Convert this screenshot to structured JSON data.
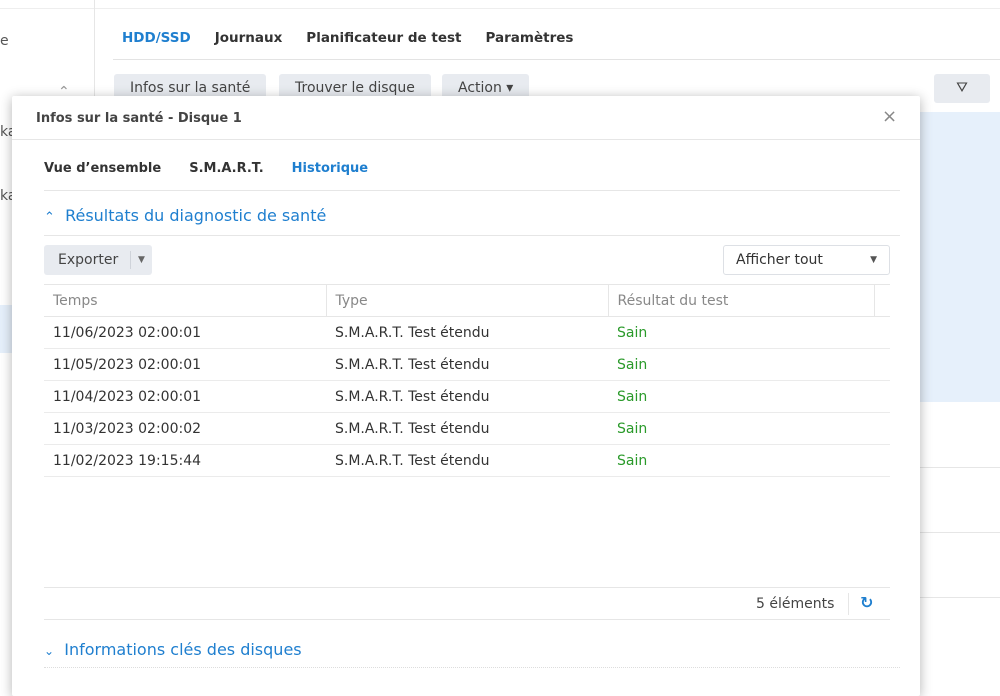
{
  "sidebar": {
    "fragments": [
      "e",
      "ka",
      "ka"
    ]
  },
  "main_tabs": [
    {
      "label": "HDD/SSD"
    },
    {
      "label": "Journaux"
    },
    {
      "label": "Planificateur de test"
    },
    {
      "label": "Paramètres"
    }
  ],
  "toolbar": {
    "health": "Infos sur la santé",
    "find": "Trouver le disque",
    "action": "Action ▾",
    "filter_icon": "filter-icon"
  },
  "dialog": {
    "title": "Infos sur la santé - Disque 1",
    "close": "×",
    "tabs": [
      {
        "label": "Vue d’ensemble"
      },
      {
        "label": "S.M.A.R.T."
      },
      {
        "label": "Historique"
      }
    ],
    "section1": "Résultats du diagnostic de santé",
    "export": "Exporter",
    "filter_select": "Afficher tout",
    "columns": [
      "Temps",
      "Type",
      "Résultat du test"
    ],
    "rows": [
      {
        "time": "11/06/2023 02:00:01",
        "type": "S.M.A.R.T. Test étendu",
        "result": "Sain"
      },
      {
        "time": "11/05/2023 02:00:01",
        "type": "S.M.A.R.T. Test étendu",
        "result": "Sain"
      },
      {
        "time": "11/04/2023 02:00:01",
        "type": "S.M.A.R.T. Test étendu",
        "result": "Sain"
      },
      {
        "time": "11/03/2023 02:00:02",
        "type": "S.M.A.R.T. Test étendu",
        "result": "Sain"
      },
      {
        "time": "11/02/2023 19:15:44",
        "type": "S.M.A.R.T. Test étendu",
        "result": "Sain"
      }
    ],
    "count": "5 éléments",
    "section2": "Informations clés des disques"
  },
  "colors": {
    "accent": "#1f7fcf",
    "ok": "#2a9a2a"
  }
}
